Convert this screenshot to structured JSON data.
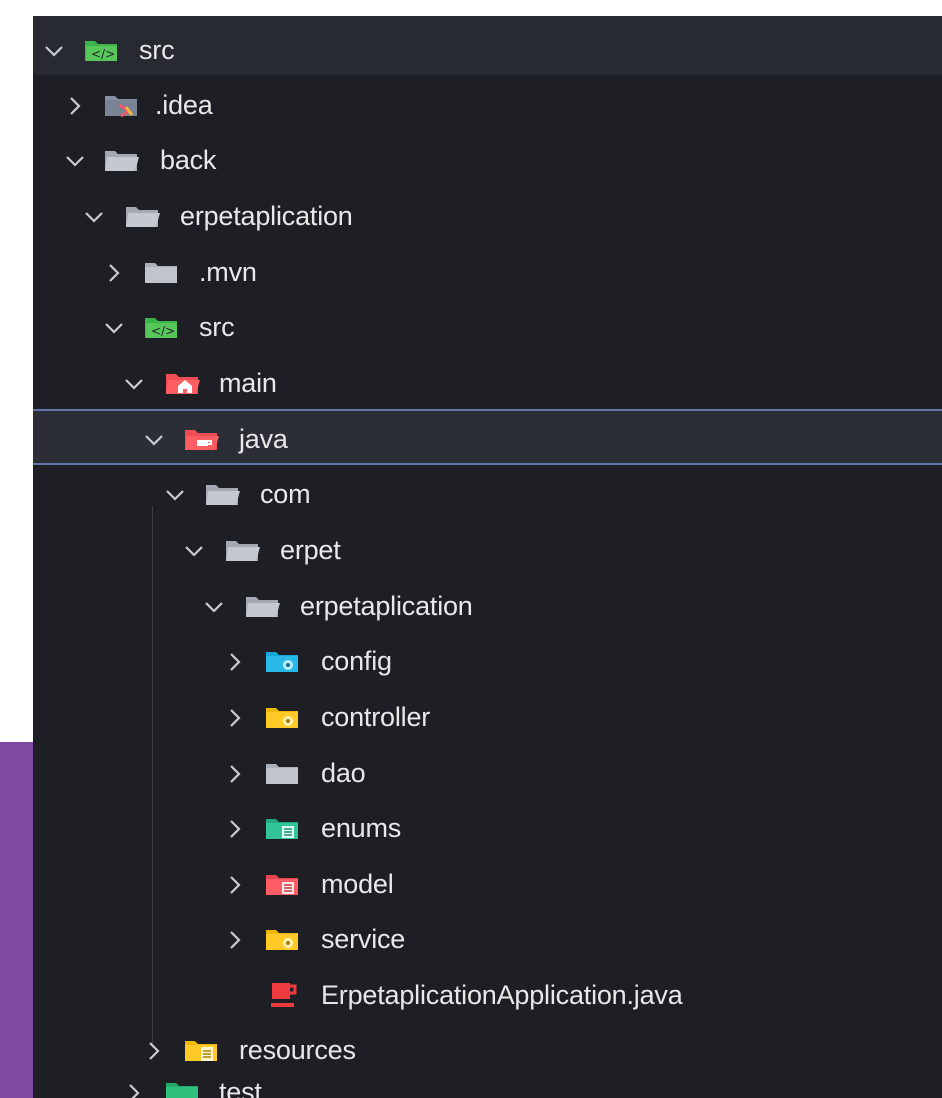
{
  "tree": {
    "items": [
      {
        "label": "src",
        "icon": "source-folder-icon",
        "expanded": true
      },
      {
        "label": ".idea",
        "icon": "idea-folder-icon",
        "expanded": false
      },
      {
        "label": "back",
        "icon": "folder-open-icon",
        "expanded": true
      },
      {
        "label": "erpetaplication",
        "icon": "folder-open-icon",
        "expanded": true
      },
      {
        "label": ".mvn",
        "icon": "folder-icon",
        "expanded": false
      },
      {
        "label": "src",
        "icon": "source-folder-icon",
        "expanded": true
      },
      {
        "label": "main",
        "icon": "main-folder-icon",
        "expanded": true
      },
      {
        "label": "java",
        "icon": "java-folder-icon",
        "expanded": true,
        "selected": true
      },
      {
        "label": "com",
        "icon": "folder-open-icon",
        "expanded": true
      },
      {
        "label": "erpet",
        "icon": "folder-open-icon",
        "expanded": true
      },
      {
        "label": "erpetaplication",
        "icon": "folder-open-icon",
        "expanded": true
      },
      {
        "label": "config",
        "icon": "config-folder-icon",
        "expanded": false
      },
      {
        "label": "controller",
        "icon": "controller-folder-icon",
        "expanded": false
      },
      {
        "label": "dao",
        "icon": "folder-icon",
        "expanded": false
      },
      {
        "label": "enums",
        "icon": "enums-folder-icon",
        "expanded": false
      },
      {
        "label": "model",
        "icon": "model-folder-icon",
        "expanded": false
      },
      {
        "label": "service",
        "icon": "service-folder-icon",
        "expanded": false
      },
      {
        "label": "ErpetaplicationApplication.java",
        "icon": "java-file-icon",
        "expanded": null
      },
      {
        "label": "resources",
        "icon": "resources-folder-icon",
        "expanded": false
      },
      {
        "label": "test",
        "icon": "test-folder-icon",
        "expanded": false
      }
    ]
  },
  "colors": {
    "background": "#1d1f25",
    "text": "#e8e8e8",
    "selection_border": "#6374aa",
    "side_panel": "#7f49a3"
  }
}
